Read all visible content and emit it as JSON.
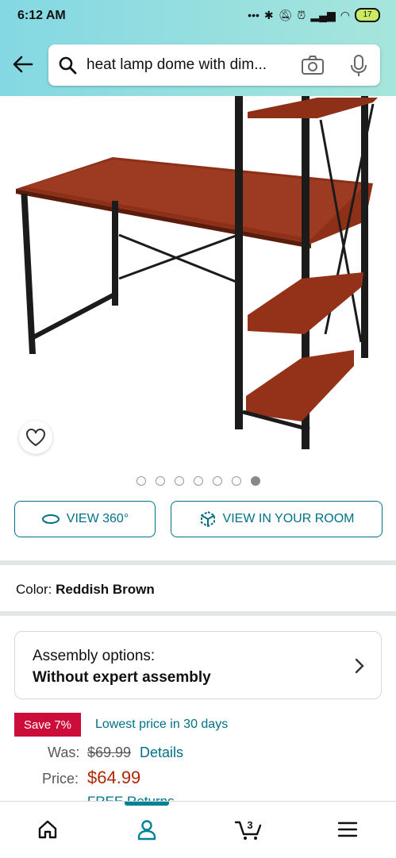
{
  "status": {
    "time": "6:12 AM",
    "battery": "17"
  },
  "search": {
    "query": "heat lamp dome with dim..."
  },
  "gallery": {
    "dots_total": 7,
    "active_index": 6
  },
  "buttons": {
    "view360": "VIEW 360°",
    "view_room": "VIEW IN YOUR ROOM"
  },
  "color": {
    "label": "Color:",
    "value": "Reddish Brown"
  },
  "assembly": {
    "label": "Assembly options:",
    "value": "Without expert assembly"
  },
  "deal": {
    "badge": "Save 7%",
    "note": "Lowest price in 30 days"
  },
  "pricing": {
    "was_label": "Was:",
    "was_value": "$69.99",
    "details_link": "Details",
    "price_label": "Price:",
    "price_value": "$64.99",
    "free_returns": "FREE Returns"
  },
  "nav": {
    "cart_count": "3"
  },
  "colors": {
    "accent": "#007185",
    "price": "#b12704",
    "badge": "#cc0c39",
    "header_start": "#84d8e3",
    "header_end": "#a6e5dc"
  }
}
